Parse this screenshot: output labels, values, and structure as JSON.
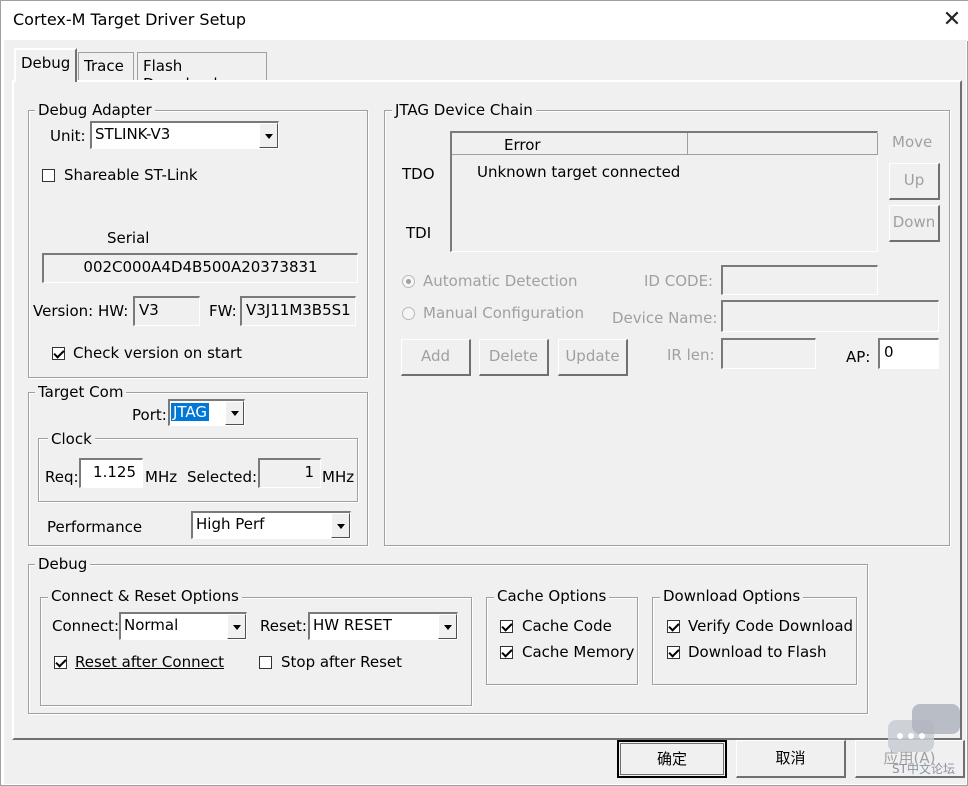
{
  "window": {
    "title": "Cortex-M Target Driver Setup"
  },
  "tabs": [
    {
      "label": "Debug"
    },
    {
      "label": "Trace"
    },
    {
      "label": "Flash Download"
    }
  ],
  "debug_adapter": {
    "title": "Debug Adapter",
    "unit_label": "Unit:",
    "unit_value": "STLINK-V3",
    "shareable_label": "Shareable ST-Link",
    "serial_label": "Serial",
    "serial_value": "002C000A4D4B500A20373831",
    "version_hw_label": "Version: HW:",
    "hw_value": "V3",
    "fw_label": "FW:",
    "fw_value": "V3J11M3B5S1",
    "check_version_label": "Check version on start"
  },
  "target_com": {
    "title": "Target Com",
    "port_label": "Port:",
    "port_value": "JTAG",
    "clock_title": "Clock",
    "req_label": "Req:",
    "req_value": "1.125",
    "mhz1": "MHz",
    "selected_label": "Selected:",
    "selected_value": "1",
    "mhz2": "MHz",
    "performance_label": "Performance",
    "performance_value": "High Perf"
  },
  "jtag_chain": {
    "title": "JTAG Device Chain",
    "col_error": "Error",
    "tdo_label": "TDO",
    "tdi_label": "TDI",
    "row_text": "Unknown target connected",
    "move_label": "Move",
    "up_label": "Up",
    "down_label": "Down",
    "auto_detect_label": "Automatic Detection",
    "manual_config_label": "Manual Configuration",
    "id_code_label": "ID CODE:",
    "device_name_label": "Device Name:",
    "add_label": "Add",
    "delete_label": "Delete",
    "update_label": "Update",
    "ir_len_label": "IR len:",
    "ap_label": "AP:",
    "ap_value": "0"
  },
  "debug_section": {
    "title": "Debug",
    "connect_reset_title": "Connect & Reset Options",
    "connect_label": "Connect:",
    "connect_value": "Normal",
    "reset_label": "Reset:",
    "reset_value": "HW RESET",
    "reset_after_connect_label": "Reset after Connect",
    "stop_after_reset_label": "Stop after Reset",
    "cache_title": "Cache Options",
    "cache_code_label": "Cache Code",
    "cache_memory_label": "Cache Memory",
    "download_title": "Download Options",
    "verify_label": "Verify Code Download",
    "download_flash_label": "Download to Flash"
  },
  "footer": {
    "ok_label": "确定",
    "cancel_label": "取消",
    "apply_label": "应用(A)"
  },
  "watermark": {
    "text": "ST中文论坛"
  }
}
